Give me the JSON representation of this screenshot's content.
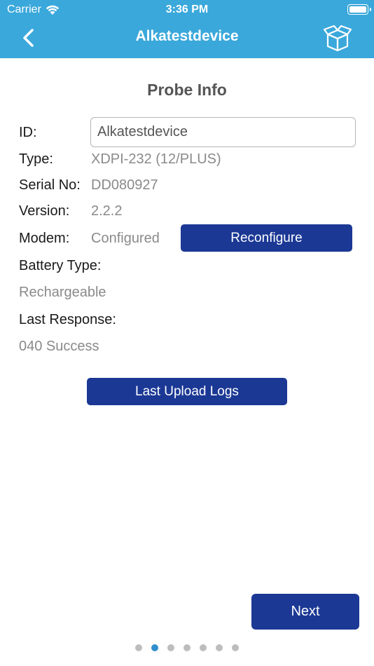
{
  "status_bar": {
    "carrier": "Carrier",
    "time": "3:36 PM",
    "wifi_icon": "wifi-icon",
    "battery_icon": "battery-icon"
  },
  "nav": {
    "title": "Alkatestdevice",
    "back_icon": "chevron-left-icon",
    "right_icon": "box-icon",
    "background_color": "#3aa8db"
  },
  "section_title": "Probe Info",
  "fields": {
    "id_label": "ID:",
    "id_value": "Alkatestdevice",
    "type_label": "Type:",
    "type_value": "XDPI-232 (12/PLUS)",
    "serial_label": "Serial No:",
    "serial_value": "DD080927",
    "version_label": "Version:",
    "version_value": "2.2.2",
    "modem_label": "Modem:",
    "modem_value": "Configured",
    "battery_type_label": "Battery Type:",
    "battery_type_value": "Rechargeable",
    "last_response_label": "Last Response:",
    "last_response_value": "040 Success"
  },
  "buttons": {
    "reconfigure": "Reconfigure",
    "last_upload_logs": "Last Upload Logs",
    "next": "Next",
    "button_color": "#1b3895"
  },
  "pagination": {
    "total": 7,
    "current": 2,
    "active_color": "#2f8fce"
  }
}
